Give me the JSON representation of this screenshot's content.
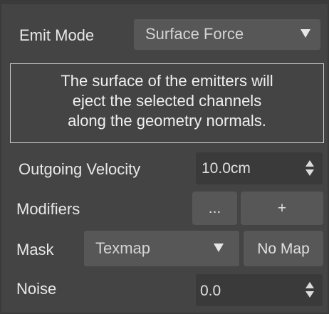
{
  "emit_mode": {
    "label": "Emit Mode",
    "value": "Surface Force",
    "icon": "chevron-down-icon"
  },
  "description": {
    "lines": [
      "The surface of the emitters will",
      "eject the selected channels",
      "along the geometry normals."
    ]
  },
  "outgoing_velocity": {
    "label": "Outgoing Velocity",
    "value": "10.0cm",
    "icon": "spinner-arrows-icon"
  },
  "modifiers": {
    "label": "Modifiers",
    "more_label": "...",
    "add_label": "+"
  },
  "mask": {
    "label": "Mask",
    "type_value": "Texmap",
    "map_button_label": "No Map",
    "icon": "chevron-down-icon"
  },
  "noise": {
    "label": "Noise",
    "value": "0.0",
    "icon": "spinner-arrows-icon"
  },
  "colors": {
    "panel_bg": "#444444",
    "dropdown_bg": "#575757",
    "spinner_bg": "#3a3a3a",
    "text": "#e6e6e6"
  }
}
